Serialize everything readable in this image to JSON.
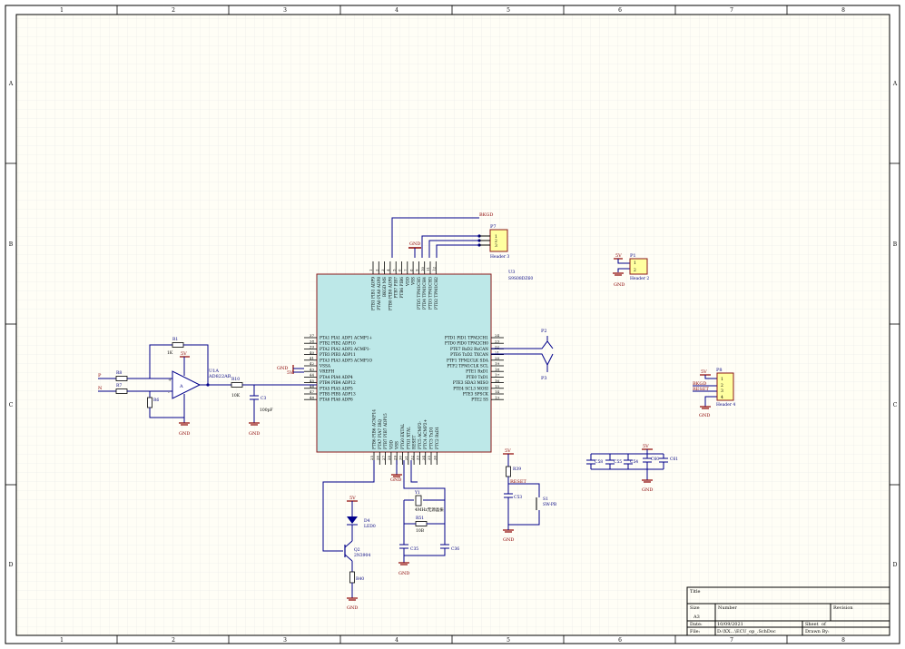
{
  "frame": {
    "cols": [
      "1",
      "2",
      "3",
      "4",
      "5",
      "6",
      "7",
      "8"
    ],
    "rows": [
      "A",
      "B",
      "C",
      "D"
    ]
  },
  "mcu": {
    "designator": "U3",
    "part": "S9S08DZ60",
    "left_pins": [
      {
        "num": "37",
        "name": "PTA1 PIA1 ADP1 ACMP1+"
      },
      {
        "num": "38",
        "name": "PTB2 PIB2 ADP10"
      },
      {
        "num": "39",
        "name": "PTA2 PIA2 ADP2 ACMP1-"
      },
      {
        "num": "40",
        "name": "PTB3 PIB3 ADP11"
      },
      {
        "num": "41",
        "name": "PTA3 PIA3 ADP3 ACMP1O"
      },
      {
        "num": "42",
        "name": "VSSA"
      },
      {
        "num": "43",
        "name": "VREFH"
      },
      {
        "num": "44",
        "name": "PTA4 PIA4 ADP4"
      },
      {
        "num": "45",
        "name": "PTB4 PIB4 ADP12"
      },
      {
        "num": "46",
        "name": "PTA5 PIA5 ADP5"
      },
      {
        "num": "47",
        "name": "PTB5 PIB5 ADP13"
      },
      {
        "num": "48",
        "name": "PTA6 PIA6 ADP6"
      }
    ],
    "right_pins": [
      {
        "num": "24",
        "name": "PTD1 PID1 TPM2CH1"
      },
      {
        "num": "23",
        "name": "PTD0 PID0 TPM2CH0"
      },
      {
        "num": "22",
        "name": "PTE7 RxD2 RxCAN"
      },
      {
        "num": "21",
        "name": "PTE6 TxD2 TXCAN"
      },
      {
        "num": "20",
        "name": "PTF1 TPM2CLK SDA"
      },
      {
        "num": "19",
        "name": "PTF2 TPM1CLK SCL"
      },
      {
        "num": "18",
        "name": "PTE1 RxD1"
      },
      {
        "num": "17",
        "name": "PTE0 TxD1"
      },
      {
        "num": "16",
        "name": "PTE3 SDA3 MISO"
      },
      {
        "num": "15",
        "name": "PTE4 SCL3 MOSI"
      },
      {
        "num": "14",
        "name": "PTE3 SPSCK"
      },
      {
        "num": "13",
        "name": "PTE2 SS"
      }
    ],
    "top_pins": [
      {
        "num": "1",
        "name": "PTB1 PIB1 ADP9"
      },
      {
        "num": "2",
        "name": "PTA0 PIA0 ADP8"
      },
      {
        "num": "3",
        "name": "BKGD MS"
      },
      {
        "num": "4",
        "name": "PTB0 PIB0 ADP8"
      },
      {
        "num": "5",
        "name": "PTB7 PIB7"
      },
      {
        "num": "6",
        "name": "PTB6 PIB6"
      },
      {
        "num": "7",
        "name": "VDD"
      },
      {
        "num": "8",
        "name": "VSS"
      },
      {
        "num": "9",
        "name": "PTD5 TPM1CH5"
      },
      {
        "num": "10",
        "name": "PTD4 TPM1CH4"
      },
      {
        "num": "11",
        "name": "PTD3 TPM1CH3"
      },
      {
        "num": "12",
        "name": "PTD2 TPM1CH2"
      }
    ],
    "bottom_pins": [
      {
        "num": "25",
        "name": "PTB6 PIB6 ACMP14"
      },
      {
        "num": "26",
        "name": "PTA7 PIA7 IRQ"
      },
      {
        "num": "27",
        "name": "PTB7 PIB7 ADP15"
      },
      {
        "num": "28",
        "name": "VDD"
      },
      {
        "num": "29",
        "name": "VSS"
      },
      {
        "num": "30",
        "name": "PTG0 EXTAL"
      },
      {
        "num": "31",
        "name": "PTG1 XTAL"
      },
      {
        "num": "32",
        "name": "RESET"
      },
      {
        "num": "33",
        "name": "PTC5 ACMP2-"
      },
      {
        "num": "34",
        "name": "PTC4 ACMP2+"
      },
      {
        "num": "35",
        "name": "PTC3 TxD1"
      },
      {
        "num": "36",
        "name": "PTC2 RxD1"
      }
    ]
  },
  "labels": {
    "bkgd": "BKGD",
    "p7": "P7",
    "p7_part": "Header 3",
    "p1": "P1",
    "p1_part": "Header 2",
    "p8": "P8",
    "p8_part": "Header 4",
    "p2": "P2",
    "p3": "P3",
    "gnd": "GND",
    "v5": "5V",
    "u1a": "U1A",
    "u1a_part": "AD822AR",
    "r1": "R1",
    "r1_val": "1K",
    "r6": "R6",
    "r7": "R7",
    "r8": "R8",
    "r10": "R10",
    "r10_val": "10K",
    "c3": "C3",
    "c3_val": "100pF",
    "p_in": "P",
    "n_in": "N",
    "a_mark": "A",
    "reset": "RESET",
    "r39": "R39",
    "c53": "C53",
    "s1": "S1",
    "s1_part": "SW-PB",
    "y1": "Y1",
    "y1_part": "4MHz无源晶振",
    "r51": "R51",
    "r51_val": "10B",
    "c35": "C35",
    "c36": "C36",
    "d4": "D4",
    "d4_part": "LED0",
    "q2": "Q2",
    "q2_part": "2N3904",
    "r40": "R40",
    "c58": "C58",
    "c55": "C55",
    "c54": "C54",
    "c60": "C60",
    "c61": "C61",
    "p8_bkgd": "BKGD",
    "p8_reset": "RESET",
    "pin1": "1",
    "pin2": "2",
    "pin3": "3",
    "pin4": "4"
  },
  "title_block": {
    "title": "Title",
    "size_label": "Size",
    "size": "A3",
    "number_label": "Number",
    "revision_label": "Revision",
    "date_label": "Date:",
    "date": "10/09/2021",
    "file_label": "File:",
    "file": "D:\\XX...\\ECU_op_.SchDoc",
    "sheet_label": "Sheet",
    "of_label": "of",
    "drawn_label": "Drawn By:"
  }
}
